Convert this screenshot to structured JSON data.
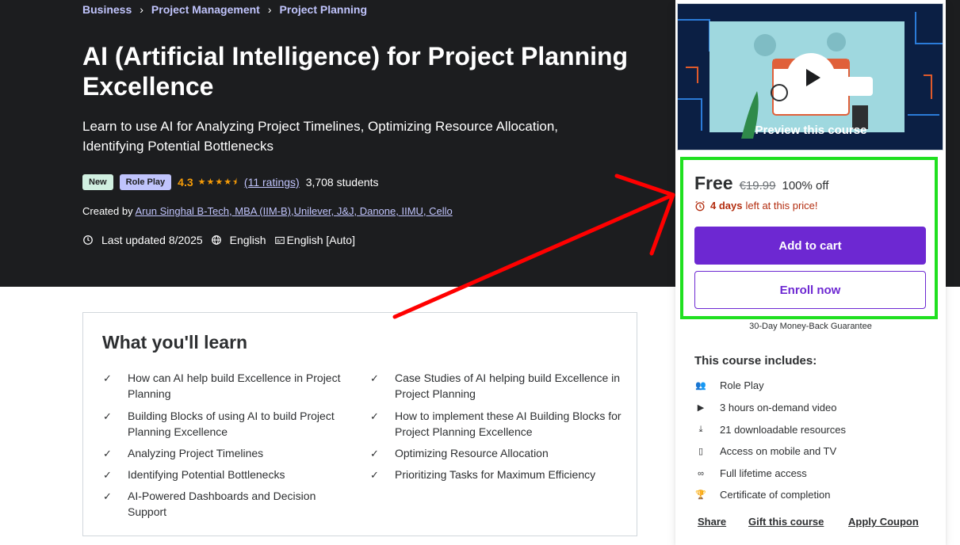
{
  "breadcrumb": {
    "items": [
      "Business",
      "Project Management",
      "Project Planning"
    ],
    "separator": "›"
  },
  "course": {
    "title": "AI (Artificial Intelligence) for Project Planning Excellence",
    "subtitle": "Learn to use AI for Analyzing Project Timelines, Optimizing Resource Allocation, Identifying Potential Bottlenecks",
    "badge_new": "New",
    "badge_role": "Role Play",
    "rating": "4.3",
    "stars": "★★★★⯨",
    "ratings_link": "(11 ratings)",
    "students": "3,708 students",
    "created_label": "Created by",
    "instructor": "Arun Singhal B-Tech, MBA (IIM-B),Unilever, J&J, Danone, IIMU, Cello",
    "last_updated": "Last updated 8/2025",
    "language": "English",
    "captions": "English [Auto]"
  },
  "learn": {
    "title": "What you'll learn",
    "items": [
      "How can AI help build Excellence in Project Planning",
      "Case Studies of AI helping build Excellence in Project Planning",
      "Building Blocks of using AI to build Project Planning Excellence",
      "How to implement these AI Building Blocks for Project Planning Excellence",
      "Analyzing Project Timelines",
      "Optimizing Resource Allocation",
      "Identifying Potential Bottlenecks",
      "Prioritizing Tasks for Maximum Efficiency",
      "AI-Powered Dashboards and Decision Support"
    ]
  },
  "sidebar": {
    "preview_label": "Preview this course",
    "price": "Free",
    "original_price": "€19.99",
    "discount": "100% off",
    "timer_days": "4 days",
    "timer_rest": "left at this price!",
    "add_to_cart": "Add to cart",
    "enroll": "Enroll now",
    "guarantee": "30-Day Money-Back Guarantee",
    "includes_title": "This course includes:",
    "includes": [
      {
        "icon": "role-play-icon",
        "label": "Role Play"
      },
      {
        "icon": "video-icon",
        "label": "3 hours on-demand video"
      },
      {
        "icon": "file-download-icon",
        "label": "21 downloadable resources"
      },
      {
        "icon": "mobile-icon",
        "label": "Access on mobile and TV"
      },
      {
        "icon": "infinity-icon",
        "label": "Full lifetime access"
      },
      {
        "icon": "trophy-icon",
        "label": "Certificate of completion"
      }
    ],
    "share": "Share",
    "gift": "Gift this course",
    "coupon": "Apply Coupon"
  },
  "colors": {
    "hero_bg": "#1c1d1f",
    "accent": "#6d28d2",
    "link": "#c0c4fc",
    "star": "#f69c08",
    "highlight_box": "#20e020",
    "annotation_arrow": "#ff0000"
  }
}
